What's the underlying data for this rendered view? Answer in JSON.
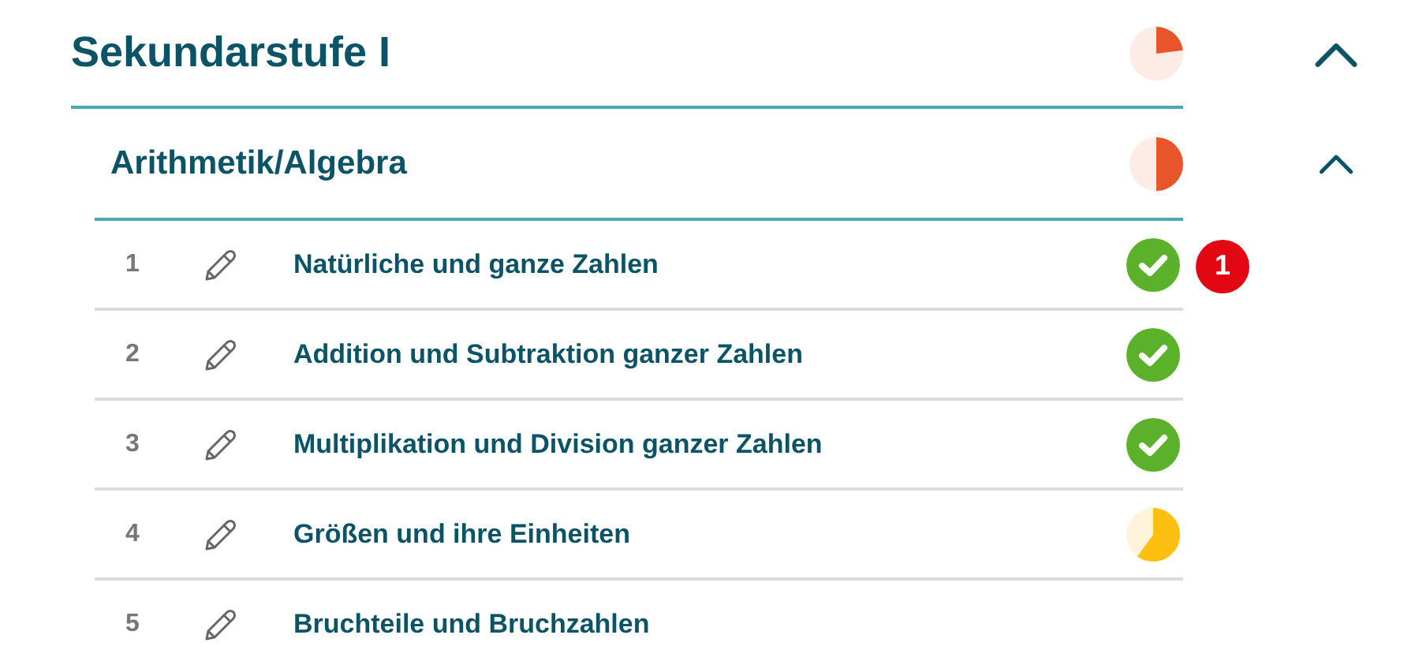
{
  "section": {
    "title": "Sekundarstufe I",
    "expanded": true,
    "subsection": {
      "title": "Arithmetik/Algebra",
      "expanded": true,
      "topics": [
        {
          "number": "1",
          "title": "Natürliche und ganze Zahlen",
          "status": {
            "kind": "done"
          },
          "badge": "1"
        },
        {
          "number": "2",
          "title": "Addition und Subtraktion ganzer Zahlen",
          "status": {
            "kind": "done"
          }
        },
        {
          "number": "3",
          "title": "Multiplikation und Division ganzer Zahlen",
          "status": {
            "kind": "done"
          }
        },
        {
          "number": "4",
          "title": "Größen und ihre Einheiten",
          "status": {
            "kind": "partial"
          }
        },
        {
          "number": "5",
          "title": "Bruchteile und Bruchzahlen",
          "status": {
            "kind": "none"
          }
        }
      ]
    }
  }
}
